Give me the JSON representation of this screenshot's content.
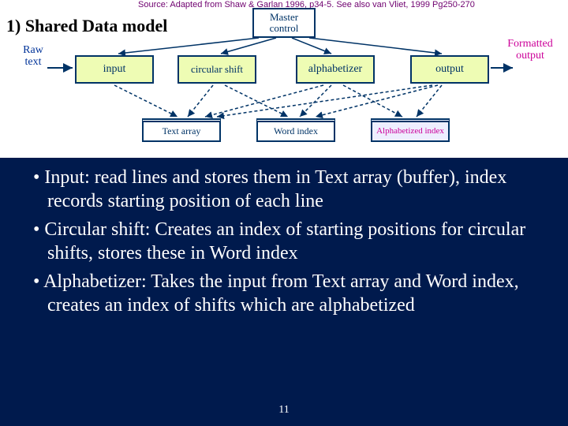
{
  "source_text": "Source: Adapted from Shaw & Garlan 1996, p34-5. See also van Vliet, 1999 Pg250-270",
  "section_title": "1) Shared Data model",
  "labels": {
    "raw_text": "Raw text",
    "formatted_output": "Formatted output"
  },
  "boxes": {
    "master": "Master control",
    "input": "input",
    "cshift": "circular shift",
    "alpha": "alphabetizer",
    "output": "output",
    "txtarr": "Text array",
    "wordidx": "Word index",
    "alphidx": "Alphabetized index"
  },
  "bullets": {
    "b1": "Input: read lines and stores them in Text array (buffer), index records starting position of each line",
    "b2": "Circular shift: Creates an index of starting positions for circular shifts, stores these in Word index",
    "b3": "Alphabetizer: Takes the input from Text array and Word index, creates an index of shifts which are alphabetized"
  },
  "pagenum": "11"
}
